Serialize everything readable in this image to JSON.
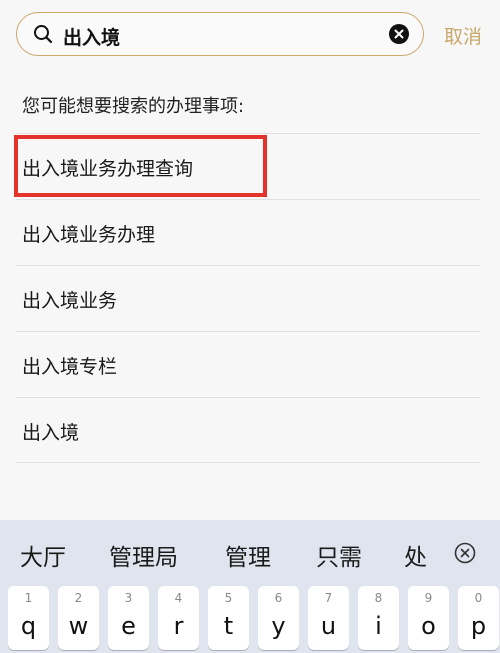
{
  "search": {
    "query": "出入境",
    "cancel_label": "取消"
  },
  "suggestions": {
    "hint": "您可能想要搜索的办理事项:",
    "items": [
      "出入境业务办理查询",
      "出入境业务办理",
      "出入境业务",
      "出入境专栏",
      "出入境"
    ]
  },
  "keyboard": {
    "candidates": [
      "大厅",
      "管理局",
      "管理",
      "只需",
      "处"
    ],
    "keys": [
      {
        "num": "1",
        "ch": "q"
      },
      {
        "num": "2",
        "ch": "w"
      },
      {
        "num": "3",
        "ch": "e"
      },
      {
        "num": "4",
        "ch": "r"
      },
      {
        "num": "5",
        "ch": "t"
      },
      {
        "num": "6",
        "ch": "y"
      },
      {
        "num": "7",
        "ch": "u"
      },
      {
        "num": "8",
        "ch": "i"
      },
      {
        "num": "9",
        "ch": "o"
      },
      {
        "num": "0",
        "ch": "p"
      }
    ]
  },
  "colors": {
    "accent": "#c9a86b",
    "highlight": "#e4332a"
  }
}
